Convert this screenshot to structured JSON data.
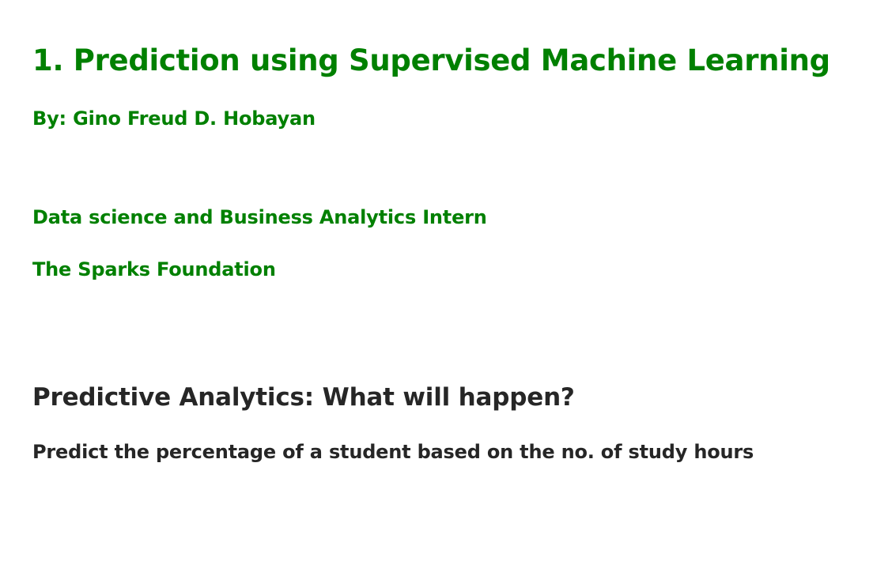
{
  "header": {
    "title": "1. Prediction using Supervised Machine Learning",
    "author": "By: Gino Freud D. Hobayan",
    "role": "Data science and Business Analytics Intern",
    "organization": "The Sparks Foundation"
  },
  "section": {
    "heading": "Predictive Analytics: What will happen?",
    "task": "Predict the percentage of a student based on the no. of study hours"
  },
  "colors": {
    "heading_green": "#008000",
    "body_dark": "#262626",
    "background": "#ffffff"
  }
}
